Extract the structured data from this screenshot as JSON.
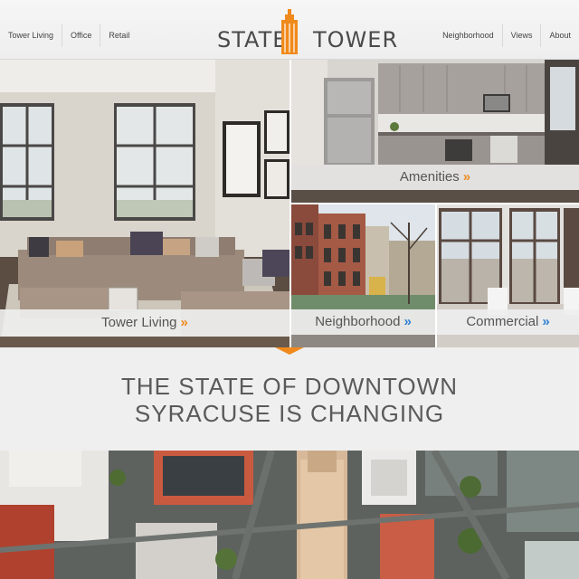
{
  "header": {
    "nav_left": [
      "Tower Living",
      "Office",
      "Retail"
    ],
    "nav_right": [
      "Neighborhood",
      "Views",
      "About"
    ],
    "logo": {
      "word_left": "STATE",
      "word_right": "TOWER"
    }
  },
  "tiles": {
    "living": {
      "caption": "Tower Living",
      "chevron": "»"
    },
    "amenities": {
      "caption": "Amenities",
      "chevron": "»"
    },
    "neighborhood": {
      "caption": "Neighborhood",
      "chevron": "»"
    },
    "commercial": {
      "caption": "Commercial",
      "chevron": "»"
    }
  },
  "tagline": {
    "line1": "THE STATE OF DOWNTOWN",
    "line2": "SYRACUSE IS CHANGING"
  },
  "colors": {
    "accent_orange": "#f08a1c",
    "accent_blue": "#2d7fd1",
    "text_gray": "#555555",
    "band_bg": "#efefef"
  }
}
